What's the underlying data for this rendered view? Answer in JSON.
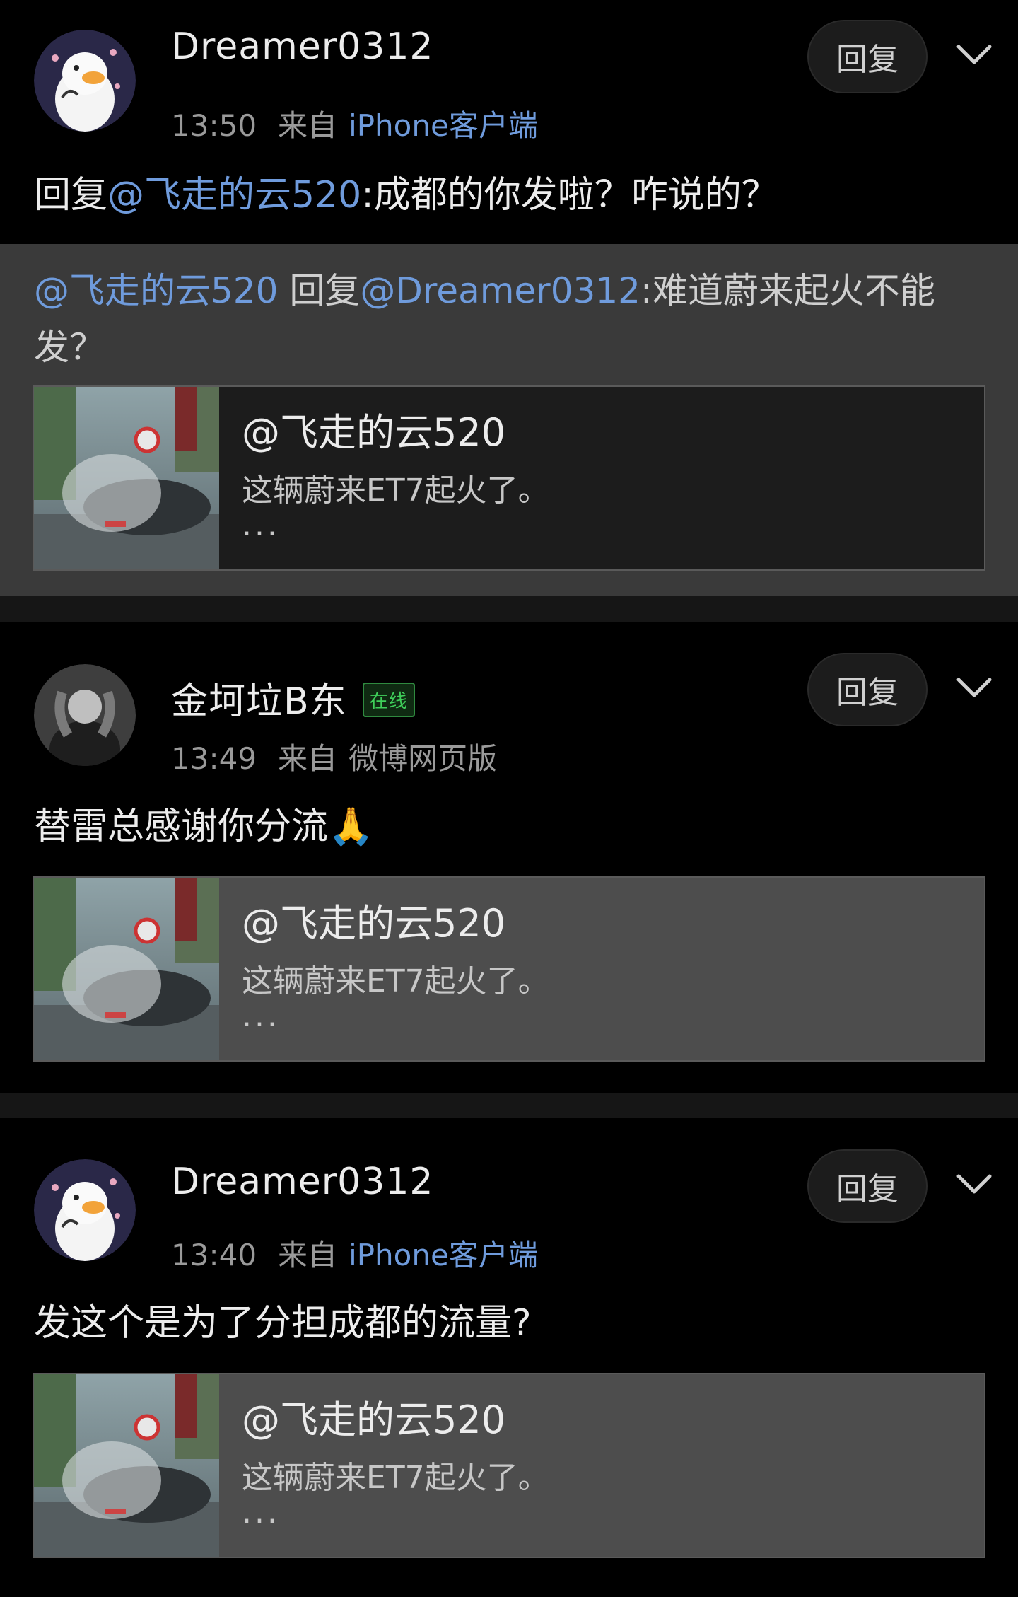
{
  "posts": [
    {
      "username": "Dreamer0312",
      "time": "13:50",
      "from_label": "来自",
      "source": "iPhone客户端",
      "reply_label": "回复",
      "text": {
        "prefix": "回复",
        "mention": "@飞走的云520",
        "rest": ":成都的你发啦？咋说的？"
      },
      "quote": {
        "mention1": "@飞走的云520",
        "middle": " 回复",
        "mention2": "@Dreamer0312",
        "rest": ":难道蔚来起火不能发？"
      },
      "card": {
        "author": "@飞走的云520",
        "desc": "这辆蔚来ET7起火了。",
        "dots": "..."
      }
    },
    {
      "username": "金坷垃B东",
      "online_badge": "在线",
      "time": "13:49",
      "from_label": "来自",
      "source": "微博网页版",
      "reply_label": "回复",
      "text": "替雷总感谢你分流🙏",
      "card": {
        "author": "@飞走的云520",
        "desc": "这辆蔚来ET7起火了。",
        "dots": "..."
      }
    },
    {
      "username": "Dreamer0312",
      "time": "13:40",
      "from_label": "来自",
      "source": "iPhone客户端",
      "reply_label": "回复",
      "text": "发这个是为了分担成都的流量?",
      "card": {
        "author": "@飞走的云520",
        "desc": "这辆蔚来ET7起火了。",
        "dots": "..."
      }
    }
  ],
  "colors": {
    "link": "#6f9bdc",
    "background": "#000000",
    "quote_bg": "#3a3a3a",
    "online": "#3fcf5a"
  }
}
